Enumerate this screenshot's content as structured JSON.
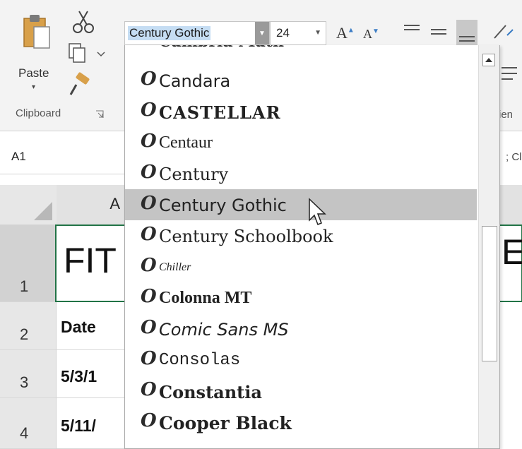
{
  "ribbon": {
    "paste_label": "Paste",
    "paste_arrow": "▾",
    "clipboard_label": "Clipboard",
    "font_name": "Century Gothic",
    "font_size": "24",
    "grow_letter": "A",
    "shrink_letter": "A",
    "alignment_label_fragment": "ien"
  },
  "formula_bar": {
    "name_box": "A1",
    "right_fragment": "; Cl"
  },
  "grid": {
    "column_a": "A",
    "rows": [
      {
        "number": "1",
        "a_value": "FIT"
      },
      {
        "number": "2",
        "a_value": "Date"
      },
      {
        "number": "3",
        "a_value": "5/3/1"
      },
      {
        "number": "4",
        "a_value": "5/11/"
      }
    ],
    "right_fragment": "E"
  },
  "font_dropdown": {
    "partial_top": "Cambria Math",
    "items": [
      {
        "name": "Candara",
        "selected": false
      },
      {
        "name": "CASTELLAR",
        "selected": false
      },
      {
        "name": "Centaur",
        "selected": false
      },
      {
        "name": "Century",
        "selected": false
      },
      {
        "name": "Century Gothic",
        "selected": true
      },
      {
        "name": "Century Schoolbook",
        "selected": false
      },
      {
        "name": "Chiller",
        "selected": false
      },
      {
        "name": "Colonna MT",
        "selected": false
      },
      {
        "name": "Comic Sans MS",
        "selected": false
      },
      {
        "name": "Consolas",
        "selected": false
      },
      {
        "name": "Constantia",
        "selected": false
      },
      {
        "name": "Cooper Black",
        "selected": false
      }
    ],
    "font_icon_glyph": "O"
  },
  "colors": {
    "accent_green": "#217346",
    "selected_row": "#c4c4c4",
    "name_highlight": "#c5ddf3"
  }
}
